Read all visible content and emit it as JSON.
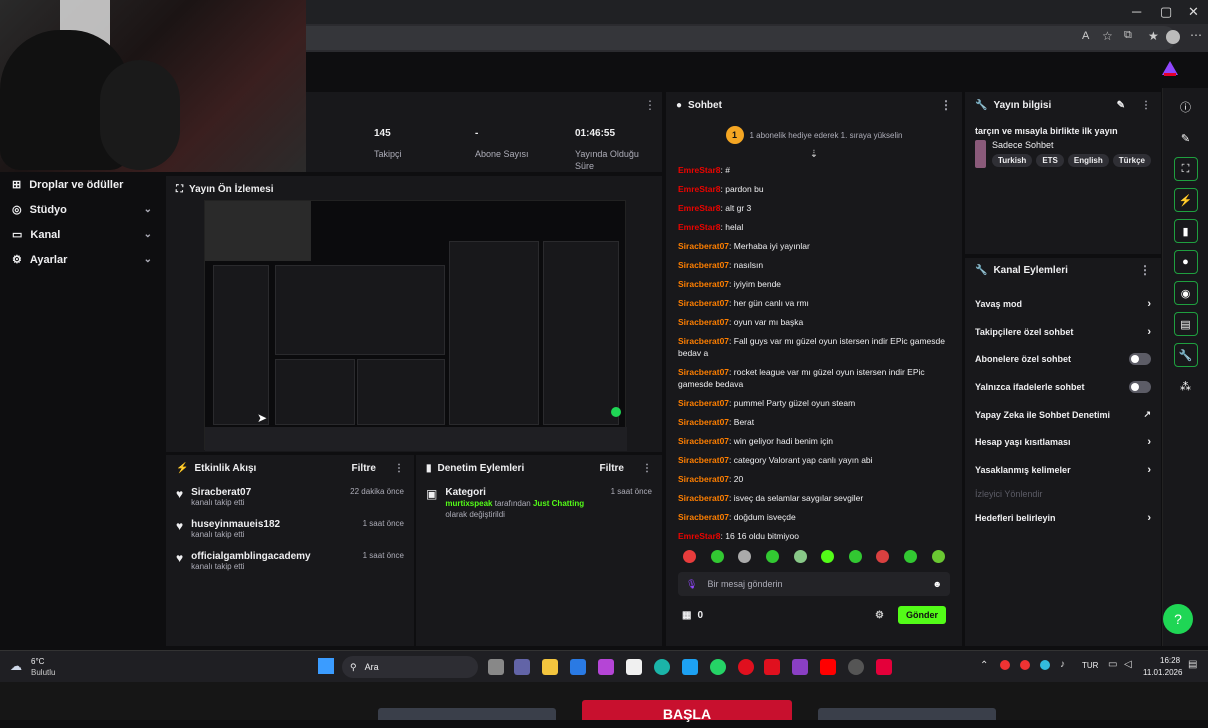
{
  "webcam": {},
  "browser": {
    "minimize": "─",
    "maximize": "▢",
    "close": "✕"
  },
  "stats": [
    {
      "value": "145",
      "label": "Takipçi"
    },
    {
      "value": "-",
      "label": "Abone Sayısı"
    },
    {
      "value": "01:46:55",
      "label": "Yayında Olduğu Süre"
    }
  ],
  "sidebar": {
    "items": [
      {
        "label": "Droplar ve ödüller",
        "icon": "gift-icon"
      },
      {
        "label": "Stüdyo",
        "icon": "studio-icon"
      },
      {
        "label": "Kanal",
        "icon": "channel-icon"
      },
      {
        "label": "Ayarlar",
        "icon": "gear-icon"
      }
    ]
  },
  "preview": {
    "title": "Yayın Ön İzlemesi"
  },
  "activity": {
    "title": "Etkinlik Akışı",
    "filter": "Filtre",
    "items": [
      {
        "name": "Siracberat07",
        "sub": "kanalı takip etti",
        "time": "22 dakika önce"
      },
      {
        "name": "huseyinmaueis182",
        "sub": "kanalı takip etti",
        "time": "1 saat önce"
      },
      {
        "name": "officialgamblingacademy",
        "sub": "kanalı takip etti",
        "time": "1 saat önce"
      }
    ]
  },
  "moderation": {
    "title": "Denetim Eylemleri",
    "filter": "Filtre",
    "item": {
      "title": "Kategori",
      "user": "murtixspeak",
      "text1": "tarafından",
      "category": "Just Chatting",
      "text2": "olarak değiştirildi",
      "time": "1 saat önce"
    }
  },
  "chat": {
    "title": "Sohbet",
    "banner": "1 abonelik hediye ederek 1. sıraya yükselin",
    "banner_rank": "1",
    "messages": [
      {
        "user": "EmreStar8",
        "color": "red",
        "text": "#"
      },
      {
        "user": "EmreStar8",
        "color": "red",
        "text": "pardon bu"
      },
      {
        "user": "EmreStar8",
        "color": "red",
        "text": "alt gr 3"
      },
      {
        "user": "EmreStar8",
        "color": "red",
        "text": "helal"
      },
      {
        "user": "Siracberat07",
        "color": "orange",
        "text": "Merhaba iyi yayınlar"
      },
      {
        "user": "Siracberat07",
        "color": "orange",
        "text": "nasılsın"
      },
      {
        "user": "Siracberat07",
        "color": "orange",
        "text": "iyiyim bende"
      },
      {
        "user": "Siracberat07",
        "color": "orange",
        "text": "her gün canlı va rmı"
      },
      {
        "user": "Siracberat07",
        "color": "orange",
        "text": "oyun var mı başka"
      },
      {
        "user": "Siracberat07",
        "color": "orange",
        "text": "Fall guys var mı güzel oyun istersen indir EPic gamesde bedav a"
      },
      {
        "user": "Siracberat07",
        "color": "orange",
        "text": "rocket league var mı güzel oyun istersen indir EPic gamesde bedava"
      },
      {
        "user": "Siracberat07",
        "color": "orange",
        "text": "pummel Party güzel oyun steam"
      },
      {
        "user": "Siracberat07",
        "color": "orange",
        "text": "Berat"
      },
      {
        "user": "Siracberat07",
        "color": "orange",
        "text": "win geliyor hadi benim için"
      },
      {
        "user": "Siracberat07",
        "color": "orange",
        "text": "category Valorant yap canlı yayın abi"
      },
      {
        "user": "Siracberat07",
        "color": "orange",
        "text": "20"
      },
      {
        "user": "Siracberat07",
        "color": "orange",
        "text": "isveç da selamlar saygılar sevgiler"
      },
      {
        "user": "Siracberat07",
        "color": "orange",
        "text": "doğdum isveçde"
      },
      {
        "user": "EmreStar8",
        "color": "red",
        "text": "16 16 oldu bitmiyoo"
      }
    ],
    "placeholder": "Bir mesaj gönderin",
    "points": "0",
    "send": "Gönder"
  },
  "stream_info": {
    "title": "Yayın bilgisi",
    "stream_title": "tarçın ve mısayla birlikte ilk yayın",
    "category": "Sadece Sohbet",
    "tags": [
      "Turkish",
      "ETS",
      "English",
      "Türkçe"
    ]
  },
  "channel_actions": {
    "title": "Kanal Eylemleri",
    "rows": [
      {
        "label": "Yavaş mod",
        "kind": "arrow"
      },
      {
        "label": "Takipçilere özel sohbet",
        "kind": "arrow"
      },
      {
        "label": "Abonelere özel sohbet",
        "kind": "toggle"
      },
      {
        "label": "Yalnızca ifadelerle sohbet",
        "kind": "toggle"
      },
      {
        "label": "Yapay Zeka ile Sohbet Denetimi",
        "kind": "external"
      },
      {
        "label": "Hesap yaşı kısıtlaması",
        "kind": "arrow"
      },
      {
        "label": "Yasaklanmış kelimeler",
        "kind": "arrow"
      },
      {
        "label": "İzleyici Yönlendir",
        "kind": "disabled"
      },
      {
        "label": "Hedefleri belirleyin",
        "kind": "arrow"
      }
    ]
  },
  "taskbar": {
    "weather_temp": "6°C",
    "weather_desc": "Bulutlu",
    "search": "Ara",
    "lang": "TUR",
    "time": "16:28",
    "date": "11.01.2026"
  },
  "bottom_buttons": {
    "center": "BAŞLA"
  }
}
